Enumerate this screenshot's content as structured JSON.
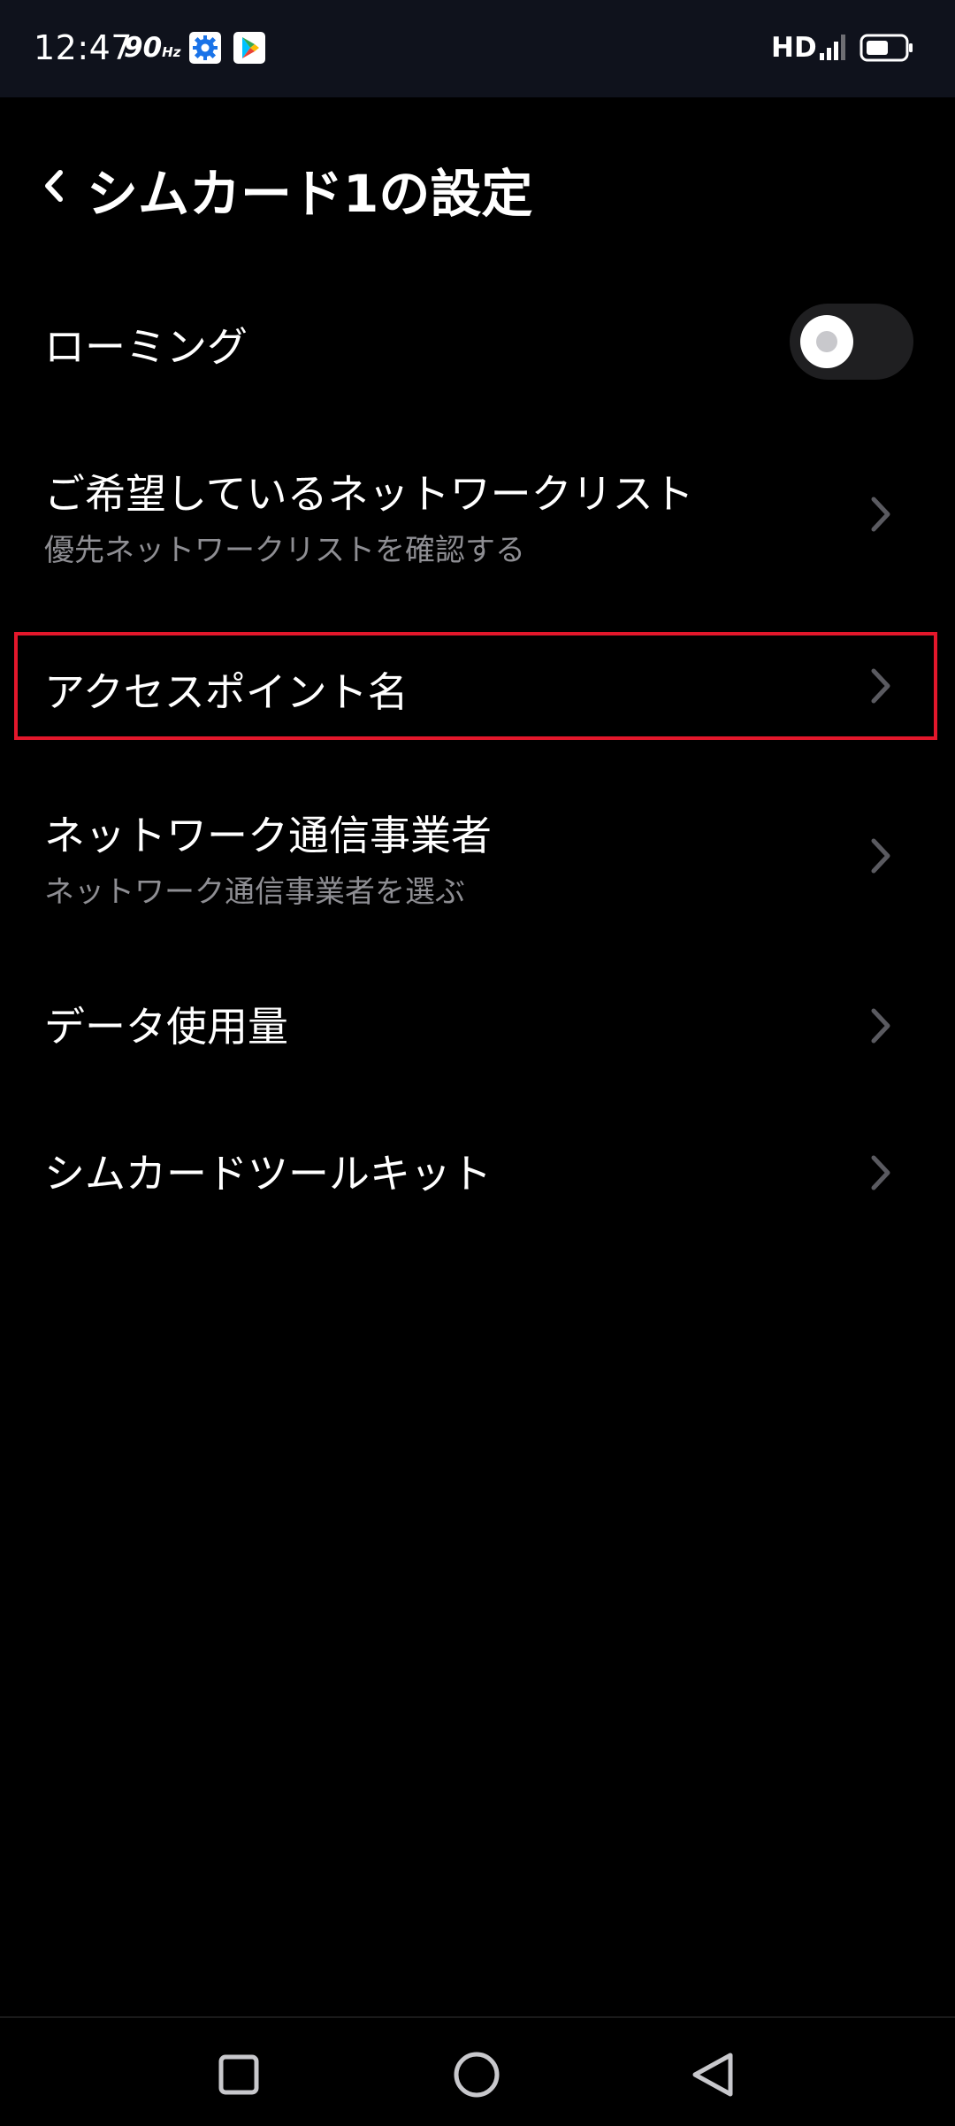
{
  "status_bar": {
    "time": "12:47",
    "refresh_rate": "90",
    "refresh_unit": "Hz",
    "network": "HD",
    "icons": [
      "settings-gear-icon",
      "play-store-icon",
      "signal-icon",
      "battery-icon"
    ]
  },
  "header": {
    "back_icon": "chevron-left-icon",
    "title": "シムカード1の設定"
  },
  "settings": {
    "roaming": {
      "title": "ローミング",
      "toggle_on": false
    },
    "preferred_network": {
      "title": "ご希望しているネットワークリスト",
      "subtitle": "優先ネットワークリストを確認する"
    },
    "access_point": {
      "title": "アクセスポイント名"
    },
    "carrier": {
      "title": "ネットワーク通信事業者",
      "subtitle": "ネットワーク通信事業者を選ぶ"
    },
    "data_usage": {
      "title": "データ使用量"
    },
    "sim_toolkit": {
      "title": "シムカードツールキット"
    }
  },
  "nav_bar": {
    "icons": [
      "recents-square-icon",
      "home-circle-icon",
      "back-triangle-icon"
    ]
  },
  "colors": {
    "background": "#000000",
    "status_bar": "#0f121c",
    "subtitle": "#8e8e93",
    "chevron": "#5a5a60",
    "highlight": "#e3172b",
    "toggle_track": "#1f1f21"
  }
}
